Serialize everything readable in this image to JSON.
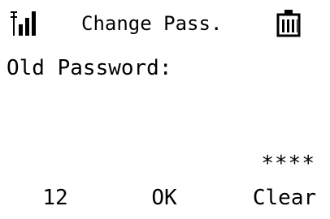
{
  "status_bar": {
    "signal_icon": "signal-strength-icon",
    "title": "Change Pass.",
    "battery_icon": "battery-full-icon"
  },
  "content": {
    "prompt_label": "Old Password:",
    "password_entry": "****"
  },
  "softkeys": {
    "left_label": "12",
    "center_label": "OK",
    "right_label": "Clear"
  }
}
